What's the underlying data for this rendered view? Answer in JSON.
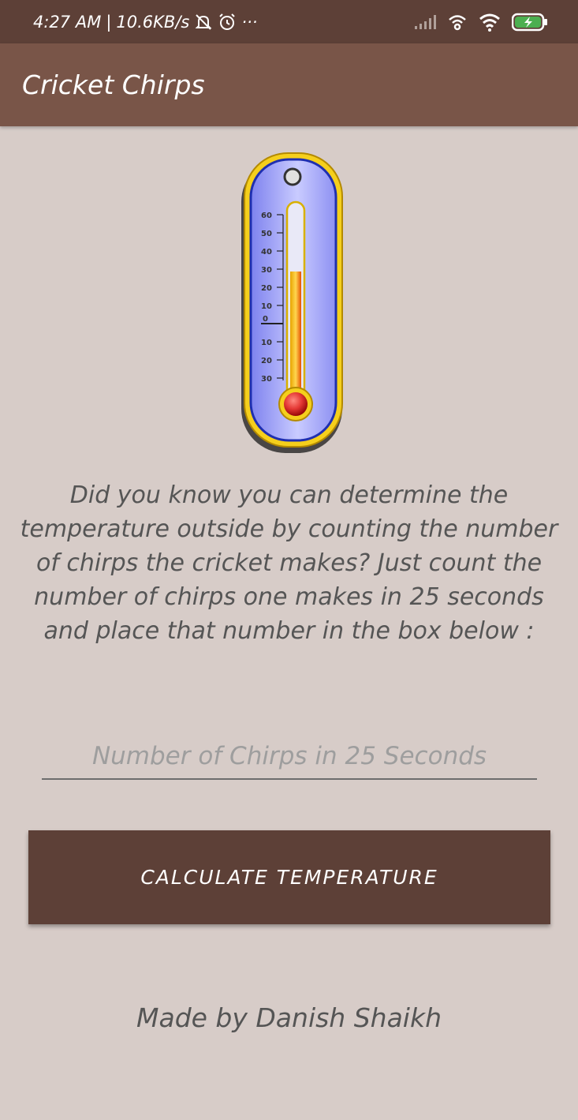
{
  "status_bar": {
    "time": "4:27 AM",
    "network_speed": "10.6KB/s",
    "more_indicator": "···",
    "icons": [
      "mute-icon",
      "alarm-icon",
      "signal-icon",
      "hotspot-icon",
      "wifi-icon",
      "battery-charging-icon"
    ]
  },
  "app_bar": {
    "title": "Cricket Chirps"
  },
  "thermometer": {
    "scale_labels": [
      "60",
      "50",
      "40",
      "30",
      "20",
      "10",
      "0",
      "10",
      "20",
      "30"
    ]
  },
  "description": "Did you know you can determine the temperature outside by counting the number of chirps the cricket makes? Just count the number of chirps one makes in 25 seconds and place that number in the box below :",
  "input": {
    "placeholder": "Number of Chirps in 25 Seconds",
    "value": ""
  },
  "button": {
    "label": "CALCULATE TEMPERATURE"
  },
  "footer": {
    "credit": "Made by Danish Shaikh"
  },
  "colors": {
    "status_bar": "#5d4037",
    "app_bar": "#795548",
    "background": "#d7ccc8",
    "button": "#5d4037",
    "thermometer_frame": "#f5cf1c",
    "thermometer_face": "#a7a9f5",
    "mercury": "#e53935"
  }
}
